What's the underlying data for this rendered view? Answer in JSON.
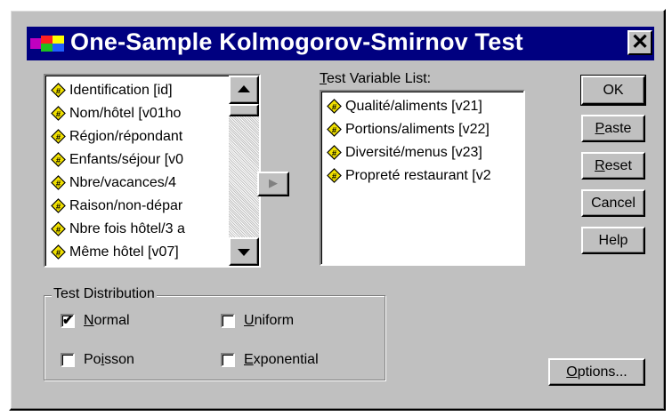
{
  "window": {
    "title": "One-Sample Kolmogorov-Smirnov Test",
    "close_glyph": "✕"
  },
  "source_list": {
    "items": [
      {
        "label": "Identification [id]"
      },
      {
        "label": "Nom/hôtel [v01ho"
      },
      {
        "label": "Région/répondant"
      },
      {
        "label": "Enfants/séjour [v0"
      },
      {
        "label": "Nbre/vacances/4"
      },
      {
        "label": "Raison/non-dépar"
      },
      {
        "label": "Nbre fois hôtel/3 a"
      },
      {
        "label": "Même hôtel [v07]"
      }
    ]
  },
  "move_button": {
    "glyph": "▶"
  },
  "test_variable_list": {
    "label_prefix": "T",
    "label_rest": "est Variable List:",
    "items": [
      {
        "label": "Qualité/aliments [v21]"
      },
      {
        "label": "Portions/aliments [v22]"
      },
      {
        "label": "Diversité/menus [v23]"
      },
      {
        "label": "Propreté restaurant [v2"
      }
    ]
  },
  "buttons": {
    "ok": {
      "pre": "",
      "u": "",
      "post": "OK"
    },
    "paste": {
      "pre": "",
      "u": "P",
      "post": "aste"
    },
    "reset": {
      "pre": "",
      "u": "R",
      "post": "eset"
    },
    "cancel": {
      "pre": "",
      "u": "",
      "post": "Cancel"
    },
    "help": {
      "pre": "",
      "u": "",
      "post": "Help"
    },
    "options": {
      "pre": "",
      "u": "O",
      "post": "ptions..."
    }
  },
  "test_distribution": {
    "legend": "Test Distribution",
    "normal": {
      "pre": "",
      "u": "N",
      "post": "ormal",
      "checked": true,
      "mark": "✔"
    },
    "uniform": {
      "pre": "",
      "u": "U",
      "post": "niform",
      "checked": false
    },
    "poisson": {
      "pre": "Po",
      "u": "i",
      "post": "sson",
      "checked": false
    },
    "exponential": {
      "pre": "",
      "u": "E",
      "post": "xponential",
      "checked": false
    }
  },
  "colors": {
    "titlebar": "#000080",
    "face": "#c0c0c0",
    "icon_fill": "#f0e000"
  }
}
